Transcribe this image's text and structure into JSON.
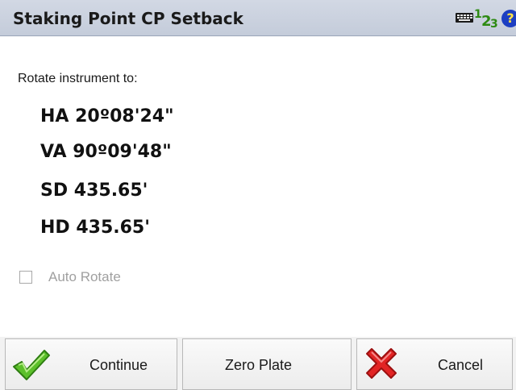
{
  "window": {
    "title": "Staking Point CP Setback"
  },
  "title_icons": {
    "keyboard": "keyboard-icon",
    "input_mode": {
      "one": "1",
      "two": "2",
      "three": "3"
    },
    "help": "?"
  },
  "prompt": "Rotate instrument to:",
  "values": {
    "ha": "HA 20º08'24\"",
    "va": "VA 90º09'48\"",
    "sd": "SD 435.65'",
    "hd": "HD 435.65'"
  },
  "auto_rotate": {
    "label": "Auto Rotate",
    "checked": false,
    "enabled": false
  },
  "buttons": {
    "continue": "Continue",
    "zero_plate": "Zero Plate",
    "cancel": "Cancel"
  },
  "colors": {
    "title_bar": "#c8cfdc",
    "check_green": "#5cc02a",
    "cancel_red": "#e22424",
    "help_blue": "#1d3fc2"
  }
}
